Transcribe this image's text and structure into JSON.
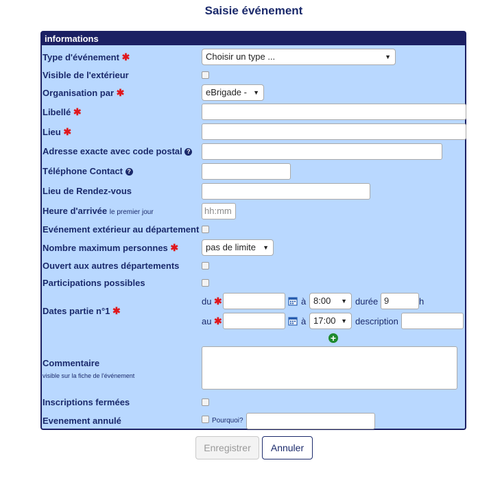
{
  "page_title": "Saisie événement",
  "panel_title": "informations",
  "required_mark": "✱",
  "help_mark": "?",
  "labels": {
    "type_event": "Type d'événement",
    "visible_ext": "Visible de l'extérieur",
    "organisation": "Organisation par",
    "libelle": "Libellé",
    "lieu": "Lieu",
    "adresse": "Adresse exacte avec code postal",
    "telephone": "Téléphone Contact",
    "rdv": "Lieu de Rendez-vous",
    "heure_arrivee": "Heure d'arrivée",
    "heure_arrivee_small": "le premier jour",
    "ext_dept": "Evénement extérieur au département",
    "nb_max": "Nombre maximum personnes",
    "ouvert": "Ouvert aux autres départements",
    "participations": "Participations possibles",
    "dates": "Dates partie n°1",
    "commentaire": "Commentaire",
    "commentaire_small": "visible sur la fiche de l'événement",
    "inscriptions": "Inscriptions fermées",
    "annule": "Evenement annulé"
  },
  "fields": {
    "type_select": "Choisir un type ...",
    "organisation_select": "eBrigade -",
    "heure_placeholder": "hh:mm",
    "nb_max_select": "pas de limite",
    "du": "du",
    "au": "au",
    "a": "à",
    "time_start": "8:00",
    "time_end": "17:00",
    "duree_label": "durée",
    "duree_value": "9",
    "duree_unit": "h",
    "description_label": "description",
    "pourquoi": "Pourquoi?"
  },
  "icons": {
    "calendar": "calendar-icon",
    "add": "plus-circle-icon",
    "help": "question-circle-icon"
  },
  "buttons": {
    "save": "Enregistrer",
    "cancel": "Annuler"
  },
  "colors": {
    "panel_bg": "#b9d8ff",
    "header_bg": "#1b2063",
    "label_text": "#1b2a6b",
    "required": "#e0161b",
    "add_icon": "#1e8a2e"
  }
}
